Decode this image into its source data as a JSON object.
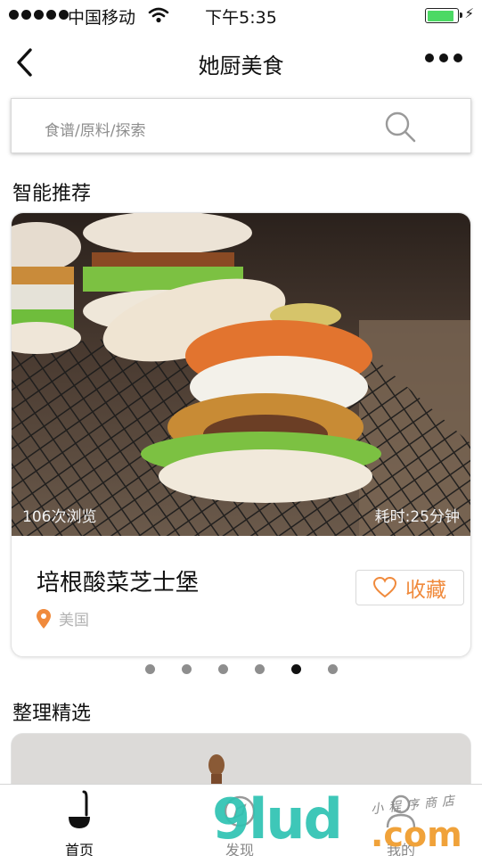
{
  "status_bar": {
    "carrier": "中国移动",
    "time": "下午5:35",
    "battery_level": 0.9
  },
  "nav": {
    "title": "她厨美食"
  },
  "search": {
    "placeholder": "食谱/原料/探索"
  },
  "sections": {
    "recommend_title": "智能推荐",
    "selected_title": "整理精选"
  },
  "recipe_card": {
    "views": "106次浏览",
    "cook_time": "耗时:25分钟",
    "name": "培根酸菜芝士堡",
    "favorite_label": "收藏",
    "location": "美国"
  },
  "carousel": {
    "count": 6,
    "active_index": 4
  },
  "tab_bar": {
    "tabs": [
      {
        "label": "首页",
        "icon": "ladle-icon",
        "active": true
      },
      {
        "label": "发现",
        "icon": "compass-icon",
        "active": false
      },
      {
        "label": "我的",
        "icon": "user-icon",
        "active": false
      }
    ]
  },
  "watermark": {
    "brand": "9lud",
    "tld": ".com",
    "tagline": "小程序商店"
  },
  "colors": {
    "accent": "#f08a3c",
    "active_dot": "#111111",
    "inactive_dot": "#8e8e8e",
    "battery": "#4cd964"
  }
}
